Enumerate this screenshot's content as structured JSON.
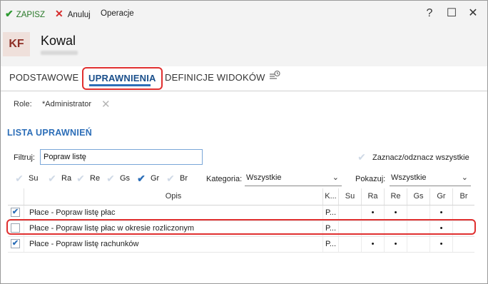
{
  "toolbar": {
    "save_label": "ZAPISZ",
    "cancel_label": "Anuluj",
    "ops_label": "Operacje",
    "help": "?",
    "maximize": "☐",
    "close": "✕"
  },
  "header": {
    "initials": "KF",
    "name": "Kowal"
  },
  "tabs": [
    {
      "label": "PODSTAWOWE"
    },
    {
      "label": "UPRAWNIENIA",
      "active": true
    },
    {
      "label": "DEFINICJE WIDOKÓW"
    }
  ],
  "role": {
    "label": "Role:",
    "value": "*Administrator"
  },
  "section_title": "LISTA UPRAWNIEŃ",
  "filter": {
    "label": "Filtruj:",
    "value": "Popraw listę"
  },
  "select_all_label": "Zaznacz/odznacz wszystkie",
  "perm_checks": [
    {
      "label": "Su",
      "checked": false
    },
    {
      "label": "Ra",
      "checked": false
    },
    {
      "label": "Re",
      "checked": false
    },
    {
      "label": "Gs",
      "checked": false
    },
    {
      "label": "Gr",
      "checked": true
    },
    {
      "label": "Br",
      "checked": false
    }
  ],
  "category": {
    "label": "Kategoria:",
    "value": "Wszystkie"
  },
  "show": {
    "label": "Pokazuj:",
    "value": "Wszystkie"
  },
  "table": {
    "columns": [
      "Opis",
      "K...",
      "Su",
      "Ra",
      "Re",
      "Gs",
      "Gr",
      "Br"
    ],
    "rows": [
      {
        "checked": true,
        "desc": "Płace - Popraw listę płac",
        "k": "P...",
        "su": "",
        "ra": "•",
        "re": "•",
        "gs": "",
        "gr": "•",
        "br": ""
      },
      {
        "checked": false,
        "desc": "Płace - Popraw listę płac w okresie rozliczonym",
        "k": "P...",
        "su": "",
        "ra": "",
        "re": "",
        "gs": "",
        "gr": "•",
        "br": ""
      },
      {
        "checked": true,
        "desc": "Płace - Popraw listę rachunków",
        "k": "P...",
        "su": "",
        "ra": "•",
        "re": "•",
        "gs": "",
        "gr": "•",
        "br": ""
      }
    ]
  },
  "colors": {
    "accent": "#2c6eb8",
    "save_green": "#2e9a32",
    "cancel_red": "#d62c2c",
    "highlight_red": "#e03030"
  }
}
